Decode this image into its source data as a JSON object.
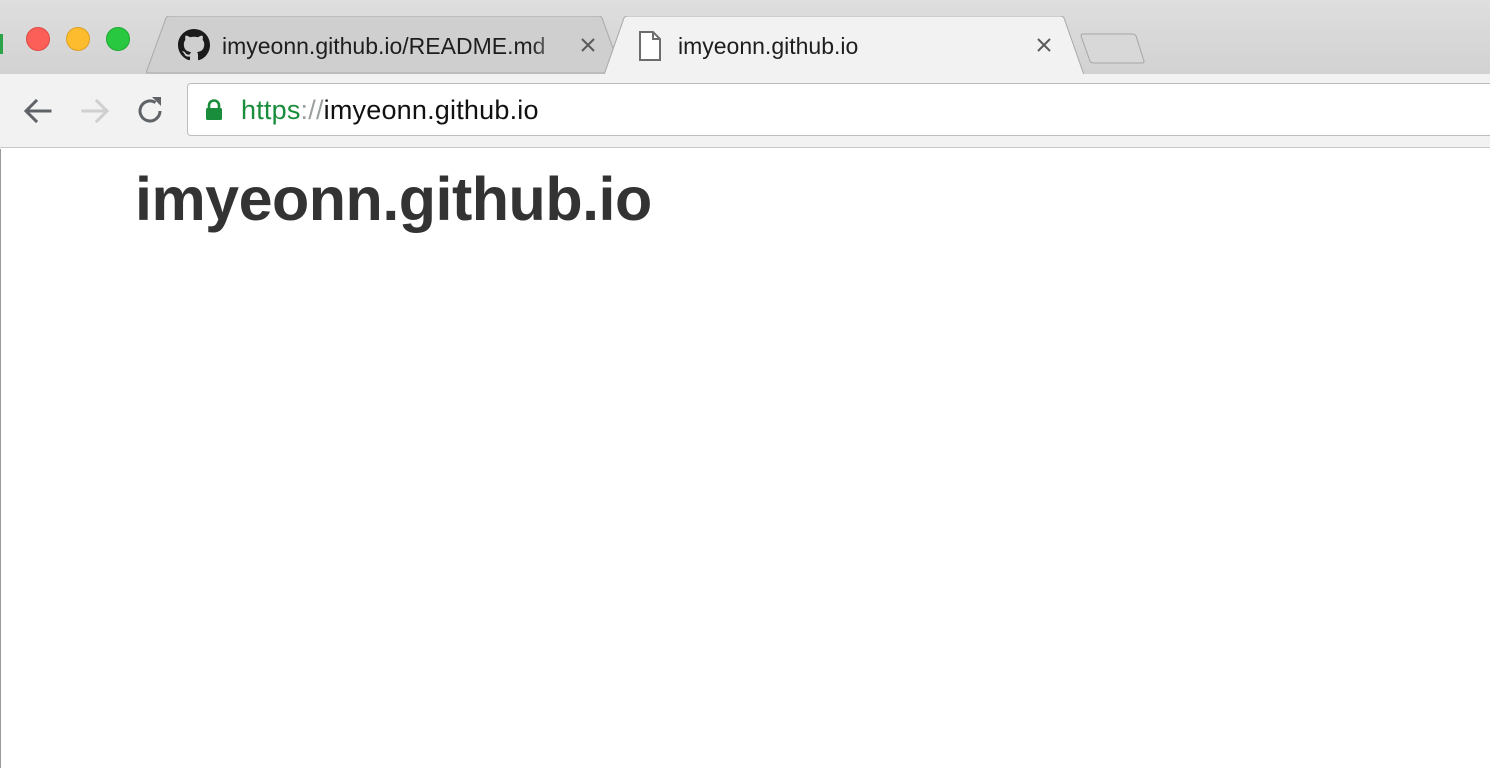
{
  "window": {
    "traffic_lights": {
      "close_color": "#fc5f57",
      "minimize_color": "#fdbc2e",
      "maximize_color": "#28c840"
    }
  },
  "tabs": [
    {
      "title": "imyeonn.github.io/README.md",
      "favicon": "github-icon",
      "active": false
    },
    {
      "title": "imyeonn.github.io",
      "favicon": "document-icon",
      "active": true
    }
  ],
  "toolbar": {
    "back_icon": "back-arrow-icon",
    "forward_icon": "forward-arrow-icon",
    "reload_icon": "reload-icon",
    "address": {
      "scheme": "https",
      "separator": "://",
      "host": "imyeonn.github.io",
      "secure_icon": "lock-icon",
      "secure_color": "#1a8d3c"
    }
  },
  "page": {
    "heading": "imyeonn.github.io"
  }
}
